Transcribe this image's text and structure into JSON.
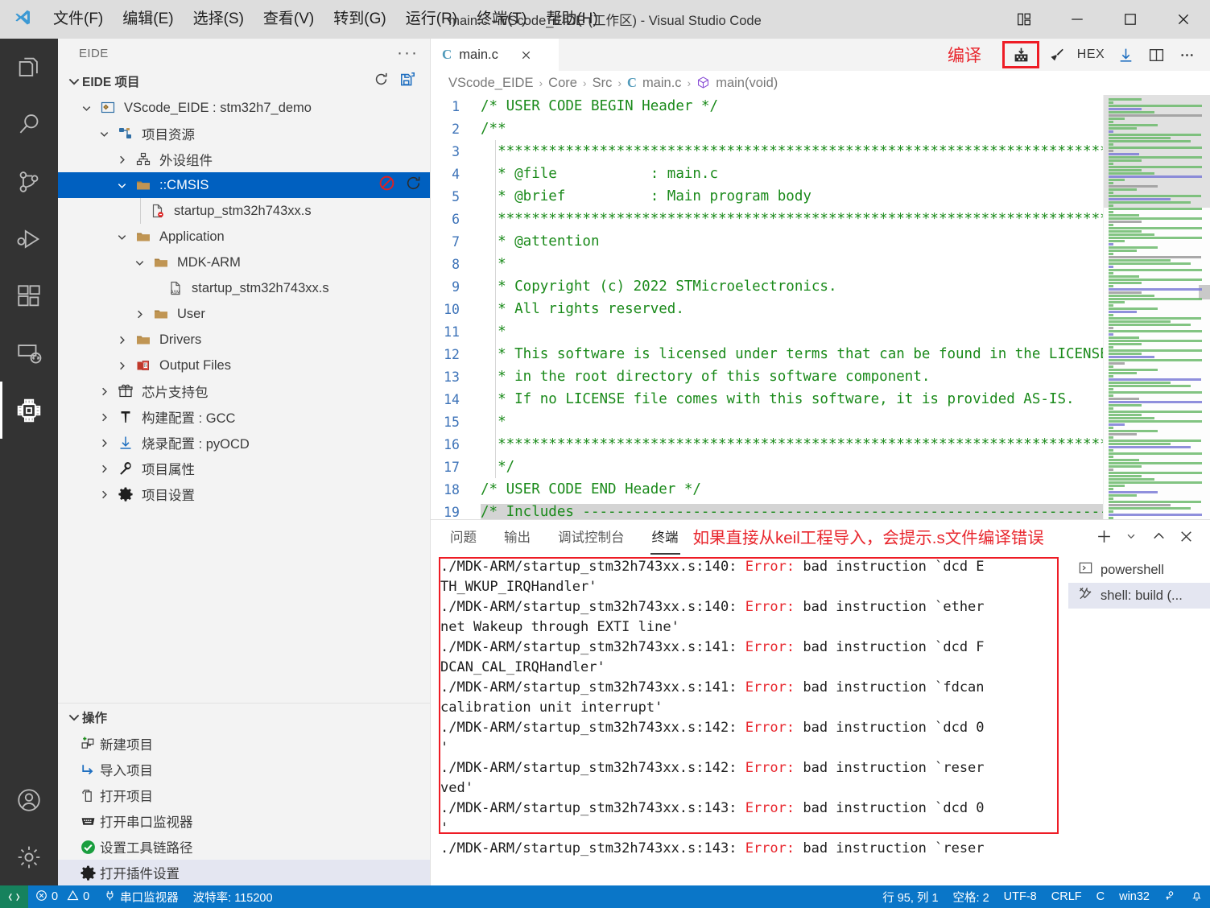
{
  "titlebar": {
    "logo_icon": "vscode-logo-icon",
    "title": "main.c - VScode_EIDE (工作区) - Visual Studio Code",
    "menus": [
      {
        "label": "文件(F)",
        "mnemonic": "F"
      },
      {
        "label": "编辑(E)",
        "mnemonic": "E"
      },
      {
        "label": "选择(S)",
        "mnemonic": "S"
      },
      {
        "label": "查看(V)",
        "mnemonic": "V"
      },
      {
        "label": "转到(G)",
        "mnemonic": "G"
      },
      {
        "label": "运行(R)",
        "mnemonic": "R"
      },
      {
        "label": "终端(T)",
        "mnemonic": "T"
      },
      {
        "label": "帮助(H)",
        "mnemonic": "H"
      }
    ],
    "controls": [
      "layout-icon",
      "minimize-icon",
      "maximize-icon",
      "close-icon"
    ]
  },
  "activitybar": {
    "items": [
      {
        "name": "explorer",
        "icon": "files-icon",
        "active": false
      },
      {
        "name": "search",
        "icon": "search-icon",
        "active": false
      },
      {
        "name": "source-control",
        "icon": "source-control-icon",
        "active": false
      },
      {
        "name": "run-debug",
        "icon": "run-debug-icon",
        "active": false
      },
      {
        "name": "extensions",
        "icon": "extensions-icon",
        "active": false
      },
      {
        "name": "remote-explorer",
        "icon": "remote-icon",
        "active": false
      },
      {
        "name": "eide",
        "icon": "chip-icon",
        "active": true
      }
    ],
    "bottom": [
      {
        "name": "accounts",
        "icon": "account-icon"
      },
      {
        "name": "manage",
        "icon": "gear-icon"
      }
    ]
  },
  "sidebar": {
    "view_title": "EIDE",
    "more_actions": "···",
    "section": {
      "label": "EIDE 项目",
      "actions": [
        "refresh-icon",
        "save-all-icon"
      ]
    },
    "tree": [
      {
        "depth": 1,
        "chev": "down",
        "icon": "workspace-icon",
        "label": "VScode_EIDE : stm32h7_demo",
        "state": "normal"
      },
      {
        "depth": 2,
        "chev": "down",
        "icon": "project-resource-icon",
        "label": "项目资源",
        "state": "normal"
      },
      {
        "depth": 3,
        "chev": "right",
        "icon": "component-icon",
        "label": "外设组件",
        "state": "normal"
      },
      {
        "depth": 3,
        "chev": "down",
        "icon": "folder-icon",
        "label": "::CMSIS",
        "state": "selected",
        "actions": [
          "exclude-icon",
          "refresh-icon"
        ]
      },
      {
        "depth": 4,
        "chev": "none",
        "icon": "file-excluded-icon",
        "label": "startup_stm32h743xx.s",
        "state": "normal"
      },
      {
        "depth": 3,
        "chev": "down",
        "icon": "folder-icon",
        "label": "Application",
        "state": "normal"
      },
      {
        "depth": 4,
        "chev": "down",
        "icon": "folder-icon",
        "label": "MDK-ARM",
        "state": "normal"
      },
      {
        "depth": 5,
        "chev": "none",
        "icon": "asm-file-icon",
        "label": "startup_stm32h743xx.s",
        "state": "normal"
      },
      {
        "depth": 4,
        "chev": "right",
        "icon": "folder-icon",
        "label": "User",
        "state": "normal"
      },
      {
        "depth": 3,
        "chev": "right",
        "icon": "folder-icon",
        "label": "Drivers",
        "state": "normal"
      },
      {
        "depth": 3,
        "chev": "right",
        "icon": "output-files-icon",
        "label": "Output Files",
        "state": "normal"
      },
      {
        "depth": 2,
        "chev": "right",
        "icon": "package-icon",
        "label": "芯片支持包",
        "state": "normal"
      },
      {
        "depth": 2,
        "chev": "right",
        "icon": "hammer-icon",
        "label": "构建配置 : GCC",
        "state": "normal"
      },
      {
        "depth": 2,
        "chev": "right",
        "icon": "download-icon",
        "label": "烧录配置 : pyOCD",
        "state": "normal"
      },
      {
        "depth": 2,
        "chev": "right",
        "icon": "wrench-icon",
        "label": "项目属性",
        "state": "normal"
      },
      {
        "depth": 2,
        "chev": "right",
        "icon": "gear-icon",
        "label": "项目设置",
        "state": "normal"
      }
    ],
    "operations": {
      "label": "操作",
      "items": [
        {
          "icon": "new-project-icon",
          "label": "新建项目",
          "highlight": false
        },
        {
          "icon": "import-project-icon",
          "label": "导入项目",
          "highlight": false
        },
        {
          "icon": "open-project-icon",
          "label": "打开项目",
          "highlight": false
        },
        {
          "icon": "serial-monitor-icon",
          "label": "打开串口监视器",
          "highlight": false
        },
        {
          "icon": "check-circle-icon",
          "label": "设置工具链路径",
          "highlight": false
        },
        {
          "icon": "gear-icon",
          "label": "打开插件设置",
          "highlight": true
        }
      ]
    }
  },
  "editor": {
    "tab": {
      "label": "main.c",
      "lang_icon": "c-file-icon",
      "close_icon": "close-icon"
    },
    "compile_annotation": "编译",
    "toolbar": [
      {
        "name": "build-button",
        "icon": "build-icon",
        "boxed": true
      },
      {
        "name": "clean-button",
        "icon": "broom-icon",
        "boxed": false
      },
      {
        "name": "hex-button",
        "label": "HEX",
        "boxed": false
      },
      {
        "name": "flash-button",
        "icon": "download-icon",
        "boxed": false
      },
      {
        "name": "split-editor-button",
        "icon": "split-editor-icon",
        "boxed": false
      },
      {
        "name": "more-actions-button",
        "icon": "ellipsis-icon",
        "boxed": false
      }
    ],
    "breadcrumb": [
      "VScode_EIDE",
      "Core",
      "Src",
      "main.c",
      "main(void)"
    ],
    "lines": [
      {
        "n": 1,
        "text": "/* USER CODE BEGIN Header */",
        "kind": "comment",
        "indent": 0
      },
      {
        "n": 2,
        "text": "/**",
        "kind": "comment",
        "indent": 0
      },
      {
        "n": 3,
        "text": "  ******************************************************************************",
        "kind": "comment",
        "indent": 1
      },
      {
        "n": 4,
        "text": "  * @file           : main.c",
        "kind": "doc-file",
        "indent": 1
      },
      {
        "n": 5,
        "text": "  * @brief          : Main program body",
        "kind": "doc-brief",
        "indent": 1
      },
      {
        "n": 6,
        "text": "  ******************************************************************************",
        "kind": "comment",
        "indent": 1
      },
      {
        "n": 7,
        "text": "  * @attention",
        "kind": "doc-attention",
        "indent": 1
      },
      {
        "n": 8,
        "text": "  *",
        "kind": "comment",
        "indent": 1
      },
      {
        "n": 9,
        "text": "  * Copyright (c) 2022 STMicroelectronics.",
        "kind": "comment",
        "indent": 1
      },
      {
        "n": 10,
        "text": "  * All rights reserved.",
        "kind": "comment",
        "indent": 1
      },
      {
        "n": 11,
        "text": "  *",
        "kind": "comment",
        "indent": 1
      },
      {
        "n": 12,
        "text": "  * This software is licensed under terms that can be found in the LICENSE file",
        "kind": "comment",
        "indent": 1
      },
      {
        "n": 13,
        "text": "  * in the root directory of this software component.",
        "kind": "comment",
        "indent": 1
      },
      {
        "n": 14,
        "text": "  * If no LICENSE file comes with this software, it is provided AS-IS.",
        "kind": "comment",
        "indent": 1
      },
      {
        "n": 15,
        "text": "  *",
        "kind": "comment",
        "indent": 1
      },
      {
        "n": 16,
        "text": "  ******************************************************************************",
        "kind": "comment",
        "indent": 1
      },
      {
        "n": 17,
        "text": "  */",
        "kind": "comment",
        "indent": 1
      },
      {
        "n": 18,
        "text": "/* USER CODE END Header */",
        "kind": "comment",
        "indent": 0
      },
      {
        "n": 19,
        "text": "/* Includes ------------------------------------------------------------------*/",
        "kind": "comment-hl",
        "indent": 0
      }
    ],
    "minimap": {
      "name": "minimap",
      "slider": "minimap-slider"
    }
  },
  "panel": {
    "tabs": [
      {
        "label": "问题",
        "active": false
      },
      {
        "label": "输出",
        "active": false
      },
      {
        "label": "调试控制台",
        "active": false
      },
      {
        "label": "终端",
        "active": true
      }
    ],
    "annotation": "如果直接从keil工程导入，会提示.s文件编译错误",
    "actions": [
      {
        "name": "new-terminal-button",
        "icon": "plus-icon"
      },
      {
        "name": "terminal-profile-dropdown",
        "icon": "chevron-down-icon"
      },
      {
        "name": "maximize-panel-button",
        "icon": "chevron-up-icon"
      },
      {
        "name": "close-panel-button",
        "icon": "close-icon"
      }
    ],
    "terminal_lines": [
      [
        {
          "t": "./MDK-ARM/startup_stm32h743xx.s:140: ",
          "c": "normal"
        },
        {
          "t": "Error:",
          "c": "error"
        },
        {
          "t": " bad instruction `dcd E",
          "c": "normal"
        }
      ],
      [
        {
          "t": "TH_WKUP_IRQHandler'",
          "c": "normal"
        }
      ],
      [
        {
          "t": "./MDK-ARM/startup_stm32h743xx.s:140: ",
          "c": "normal"
        },
        {
          "t": "Error:",
          "c": "error"
        },
        {
          "t": " bad instruction `ether",
          "c": "normal"
        }
      ],
      [
        {
          "t": "net Wakeup through EXTI line'",
          "c": "normal"
        }
      ],
      [
        {
          "t": "./MDK-ARM/startup_stm32h743xx.s:141: ",
          "c": "normal"
        },
        {
          "t": "Error:",
          "c": "error"
        },
        {
          "t": " bad instruction `dcd F",
          "c": "normal"
        }
      ],
      [
        {
          "t": "DCAN_CAL_IRQHandler'",
          "c": "normal"
        }
      ],
      [
        {
          "t": "./MDK-ARM/startup_stm32h743xx.s:141: ",
          "c": "normal"
        },
        {
          "t": "Error:",
          "c": "error"
        },
        {
          "t": " bad instruction `fdcan",
          "c": "normal"
        }
      ],
      [
        {
          "t": " calibration unit interrupt'",
          "c": "normal"
        }
      ],
      [
        {
          "t": "./MDK-ARM/startup_stm32h743xx.s:142: ",
          "c": "normal"
        },
        {
          "t": "Error:",
          "c": "error"
        },
        {
          "t": " bad instruction `dcd 0",
          "c": "normal"
        }
      ],
      [
        {
          "t": "'",
          "c": "normal"
        }
      ],
      [
        {
          "t": "./MDK-ARM/startup_stm32h743xx.s:142: ",
          "c": "normal"
        },
        {
          "t": "Error:",
          "c": "error"
        },
        {
          "t": " bad instruction `reser",
          "c": "normal"
        }
      ],
      [
        {
          "t": "ved'",
          "c": "normal"
        }
      ],
      [
        {
          "t": "./MDK-ARM/startup_stm32h743xx.s:143: ",
          "c": "normal"
        },
        {
          "t": "Error:",
          "c": "error"
        },
        {
          "t": " bad instruction `dcd 0",
          "c": "normal"
        }
      ],
      [
        {
          "t": "'",
          "c": "normal"
        }
      ],
      [
        {
          "t": "./MDK-ARM/startup_stm32h743xx.s:143: ",
          "c": "normal"
        },
        {
          "t": "Error:",
          "c": "error"
        },
        {
          "t": " bad instruction `reser",
          "c": "normal"
        }
      ]
    ],
    "terminal_list": [
      {
        "icon": "terminal-powershell-icon",
        "label": "powershell",
        "selected": false
      },
      {
        "icon": "tools-icon",
        "label": "shell: build (...",
        "selected": true
      }
    ]
  },
  "statusbar": {
    "remote_icon": "remote-icon",
    "left": [
      {
        "name": "problems",
        "icon": "error-icon",
        "label": "0",
        "icon2": "warning-icon",
        "label2": "0"
      },
      {
        "name": "serial-monitor",
        "icon": "plug-icon",
        "label": "串口监视器"
      },
      {
        "name": "baud-rate",
        "label": "波特率: 115200"
      }
    ],
    "right": [
      {
        "name": "cursor-position",
        "label": "行 95, 列 1"
      },
      {
        "name": "indentation",
        "label": "空格: 2"
      },
      {
        "name": "encoding",
        "label": "UTF-8"
      },
      {
        "name": "eol",
        "label": "CRLF"
      },
      {
        "name": "language-mode",
        "label": "C"
      },
      {
        "name": "platform",
        "label": "win32"
      },
      {
        "name": "feedback",
        "icon": "feedback-icon"
      },
      {
        "name": "notifications",
        "icon": "bell-icon"
      }
    ]
  },
  "colors": {
    "accent_blue": "#0060c0",
    "status_blue": "#0a76c8",
    "remote_green": "#16825d",
    "annotation_red": "#e8262d",
    "comment_green": "#1a8a1a",
    "doc_blue": "#3f3fbf",
    "folder_tan": "#c09553"
  }
}
